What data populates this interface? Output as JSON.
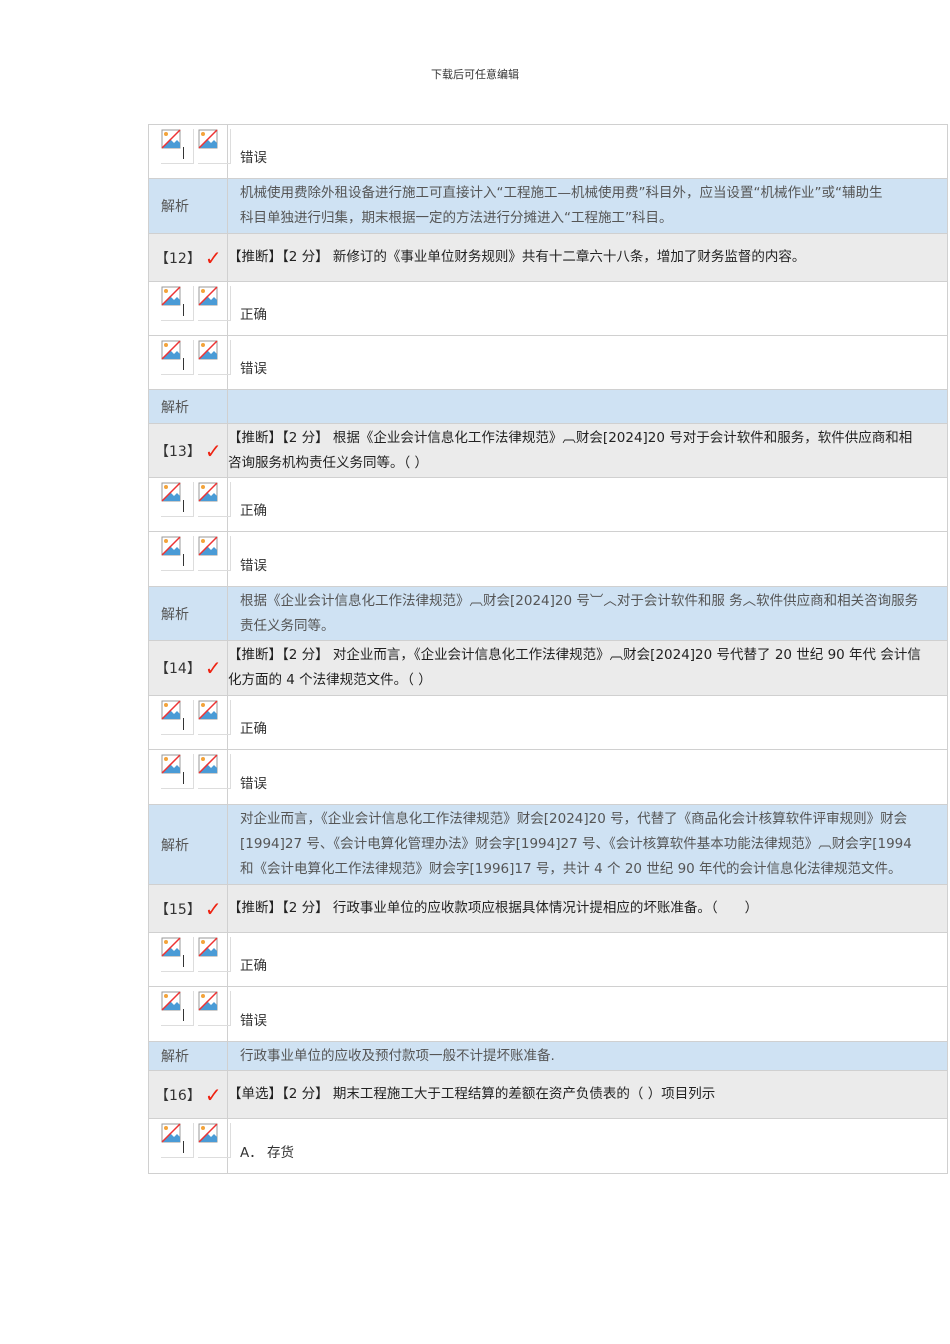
{
  "header": "下载后可任意编辑",
  "rows": [
    {
      "type": "option",
      "text": "错误"
    },
    {
      "type": "analysis",
      "label": "解析",
      "text": "机械使用费除外租设备进行施工可直接计入“工程施工—机械使用费”科目外，应当设置“机械作业”或“辅助生\n科目单独进行归集，期末根据一定的方法进行分摊进入“工程施工”科目。"
    },
    {
      "type": "question",
      "number": "【12】",
      "text": "【推断】【2 分】 新修订的《事业单位财务规则》共有十二章六十八条，增加了财务监督的内容。"
    },
    {
      "type": "option",
      "text": "正确"
    },
    {
      "type": "option",
      "text": "错误"
    },
    {
      "type": "analysis",
      "label": "解析",
      "text": ""
    },
    {
      "type": "question",
      "number": "【13】",
      "text": "【推断】【2 分】 根据《企业会计信息化工作法律规范》︹财会[2024]20 号对于会计软件和服务，软件供应商和相\n咨询服务机构责任义务同等。（ ）"
    },
    {
      "type": "option",
      "text": "正确"
    },
    {
      "type": "option",
      "text": "错误"
    },
    {
      "type": "analysis",
      "label": "解析",
      "text": "根据《企业会计信息化工作法律规范》︹财会[2024]20 号︺︿对于会计软件和服 务︿软件供应商和相关咨询服务\n责任义务同等。"
    },
    {
      "type": "question",
      "number": "【14】",
      "text": "【推断】【2 分】 对企业而言，《企业会计信息化工作法律规范》︹财会[2024]20 号代替了 20 世纪 90 年代 会计信\n化方面的 4 个法律规范文件。（ ）"
    },
    {
      "type": "option",
      "text": "正确"
    },
    {
      "type": "option",
      "text": "错误"
    },
    {
      "type": "analysis",
      "label": "解析",
      "text": "对企业而言，《企业会计信息化工作法律规范》财会[2024]20 号，代替了《商品化会计核算软件评审规则》财会\n[1994]27 号、《会计电算化管理办法》财会字[1994]27 号、《会计核算软件基本功能法律规范》︹财会字[1994\n和《会计电算化工作法律规范》财会字[1996]17 号，共计 4 个 20 世纪 90 年代的会计信息化法律规范文件。"
    },
    {
      "type": "question",
      "number": "【15】",
      "text": "【推断】【2 分】 行政事业单位的应收款项应根据具体情况计提相应的坏账准备。（　　）"
    },
    {
      "type": "option",
      "text": "正确"
    },
    {
      "type": "option",
      "text": "错误"
    },
    {
      "type": "analysis",
      "label": "解析",
      "text": "行政事业单位的应收及预付款项一般不计提坏账准备."
    },
    {
      "type": "question",
      "number": "【16】",
      "text": "【单选】【2 分】 期末工程施工大于工程结算的差额在资产负债表的（ ）项目列示"
    },
    {
      "type": "option",
      "text": "A． 存货"
    }
  ],
  "colors": {
    "check": "#ee2211",
    "analysis_bg": "#cfe2f3",
    "question_bg": "#ebebeb"
  }
}
